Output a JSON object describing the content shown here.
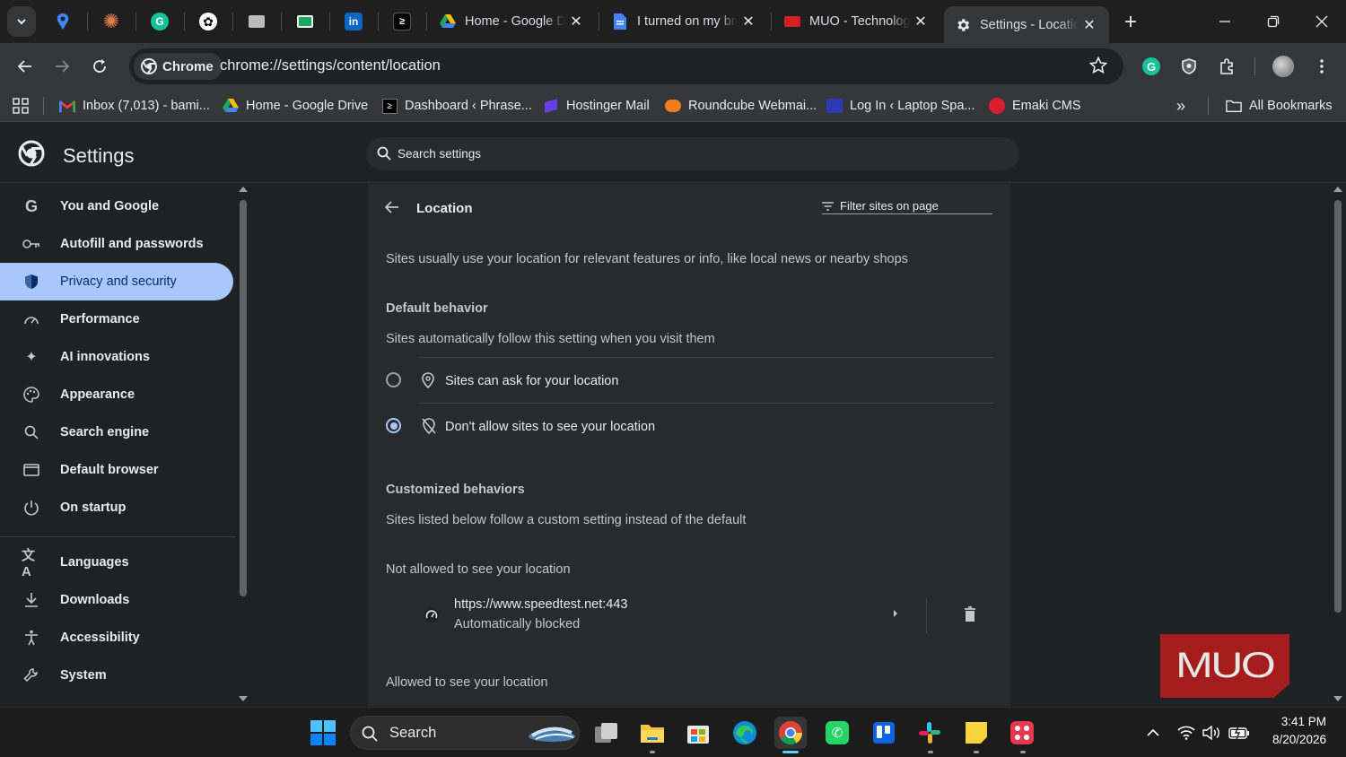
{
  "browser": {
    "tabs": [
      {
        "title": "Home - Google Drive"
      },
      {
        "title": "I turned on my browser"
      },
      {
        "title": "MUO - Technology"
      },
      {
        "title": "Settings - Location"
      }
    ],
    "chrome_chip": "Chrome",
    "url": "chrome://settings/content/location"
  },
  "bookmarks": [
    {
      "label": "Inbox (7,013) - bami..."
    },
    {
      "label": "Home - Google Drive"
    },
    {
      "label": "Dashboard ‹ Phrase..."
    },
    {
      "label": "Hostinger Mail"
    },
    {
      "label": "Roundcube Webmai..."
    },
    {
      "label": "Log In ‹ Laptop Spa..."
    },
    {
      "label": "Emaki CMS"
    }
  ],
  "all_bookmarks": "All Bookmarks",
  "settings": {
    "title": "Settings",
    "search_placeholder": "Search settings",
    "nav": [
      {
        "label": "You and Google"
      },
      {
        "label": "Autofill and passwords"
      },
      {
        "label": "Privacy and security"
      },
      {
        "label": "Performance"
      },
      {
        "label": "AI innovations"
      },
      {
        "label": "Appearance"
      },
      {
        "label": "Search engine"
      },
      {
        "label": "Default browser"
      },
      {
        "label": "On startup"
      },
      {
        "label": "Languages"
      },
      {
        "label": "Downloads"
      },
      {
        "label": "Accessibility"
      },
      {
        "label": "System"
      }
    ]
  },
  "location": {
    "title": "Location",
    "filter_placeholder": "Filter sites on page",
    "description": "Sites usually use your location for relevant features or info, like local news or nearby shops",
    "default_behavior": "Default behavior",
    "default_sub": "Sites automatically follow this setting when you visit them",
    "option_ask": "Sites can ask for your location",
    "option_block": "Don't allow sites to see your location",
    "customized": "Customized behaviors",
    "customized_sub": "Sites listed below follow a custom setting instead of the default",
    "not_allowed": "Not allowed to see your location",
    "site_url": "https://www.speedtest.net:443",
    "site_status": "Automatically blocked",
    "allowed": "Allowed to see your location"
  },
  "watermark": "MUO",
  "taskbar": {
    "search": "Search",
    "time": "3:41 PM",
    "date": "8/20/2026"
  },
  "colors": {
    "accent": "#a8c7fa",
    "background": "#202124",
    "card": "#292a2d"
  }
}
